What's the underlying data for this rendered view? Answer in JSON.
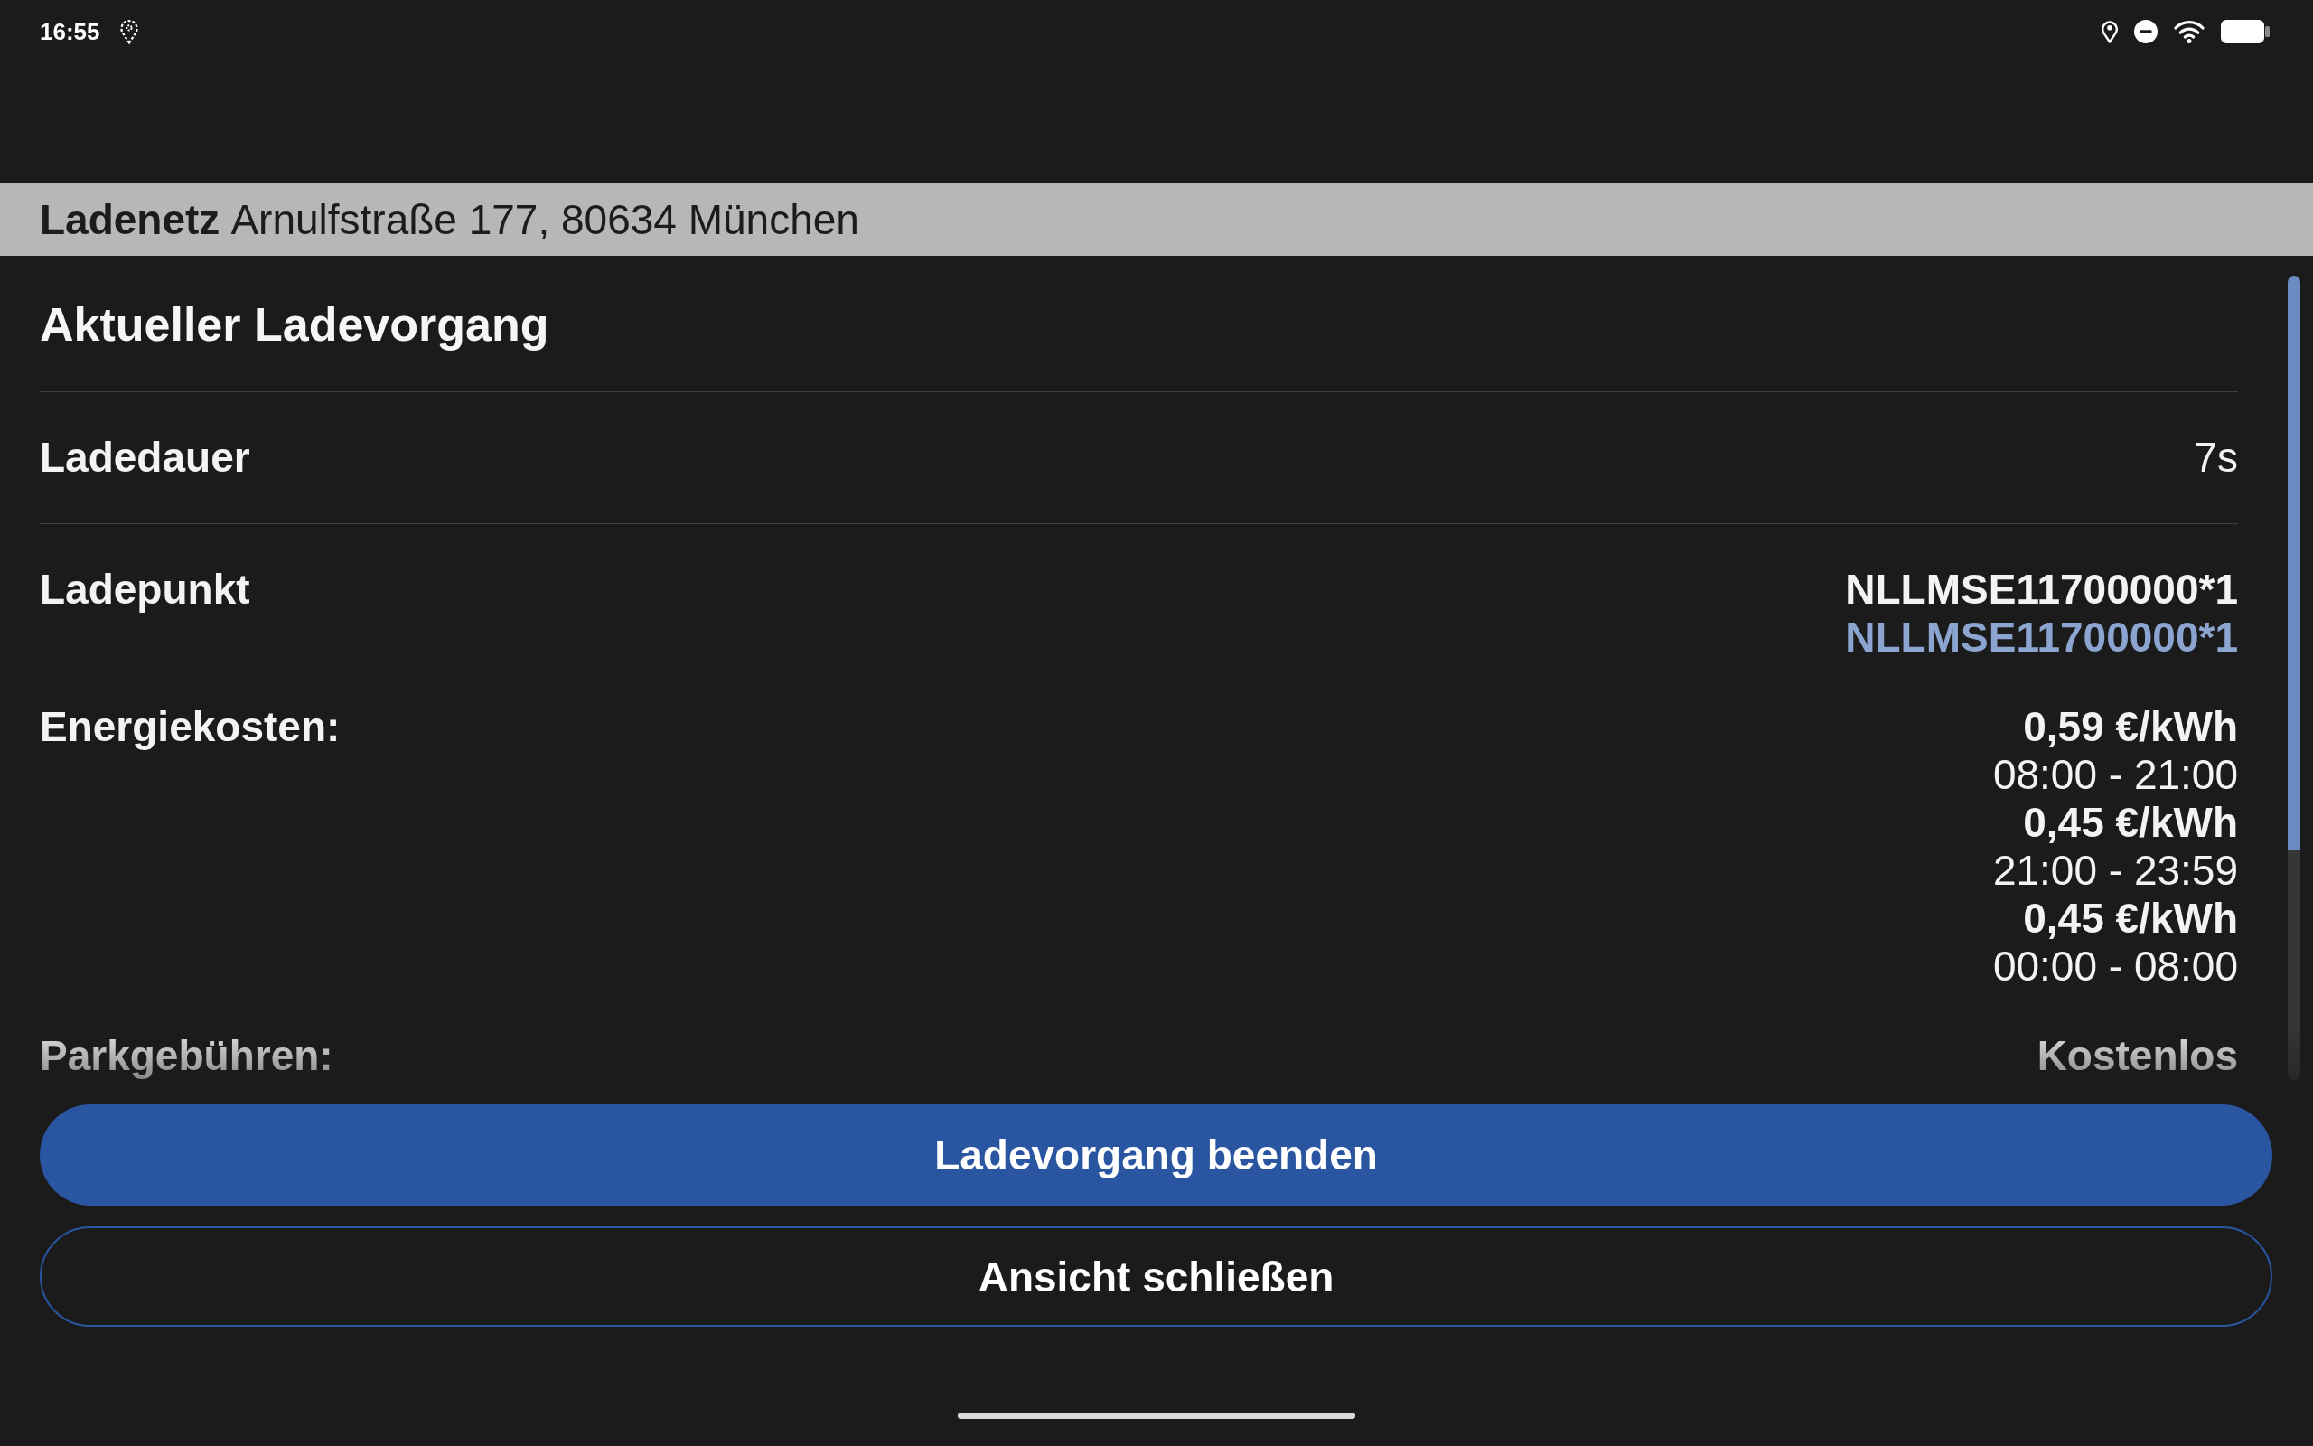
{
  "status_bar": {
    "time": "16:55"
  },
  "header": {
    "operator": "Ladenetz",
    "address": "Arnulfstraße 177, 80634 München"
  },
  "title": "Aktueller Ladevorgang",
  "details": [
    {
      "label": "Ladedauer",
      "divider": true,
      "values": [
        {
          "kind": "plain",
          "text": "7s"
        }
      ]
    },
    {
      "label": "Ladepunkt",
      "divider": false,
      "values": [
        {
          "kind": "bold",
          "text": "NLLMSE11700000*1"
        },
        {
          "kind": "link",
          "text": "NLLMSE11700000*1"
        }
      ]
    },
    {
      "label": "Energiekosten:",
      "divider": false,
      "values": [
        {
          "kind": "bold",
          "text": "0,59 €/kWh"
        },
        {
          "kind": "plain",
          "text": "08:00 - 21:00"
        },
        {
          "kind": "bold",
          "text": "0,45 €/kWh"
        },
        {
          "kind": "plain",
          "text": "21:00 - 23:59"
        },
        {
          "kind": "bold",
          "text": "0,45 €/kWh"
        },
        {
          "kind": "plain",
          "text": "00:00 - 08:00"
        }
      ]
    },
    {
      "label": "Parkgebühren:",
      "divider": false,
      "values": [
        {
          "kind": "bold",
          "text": "Kostenlos"
        }
      ]
    }
  ],
  "buttons": [
    {
      "kind": "primary",
      "label": "Ladevorgang beenden"
    },
    {
      "kind": "secondary",
      "label": "Ansicht schließen"
    }
  ]
}
